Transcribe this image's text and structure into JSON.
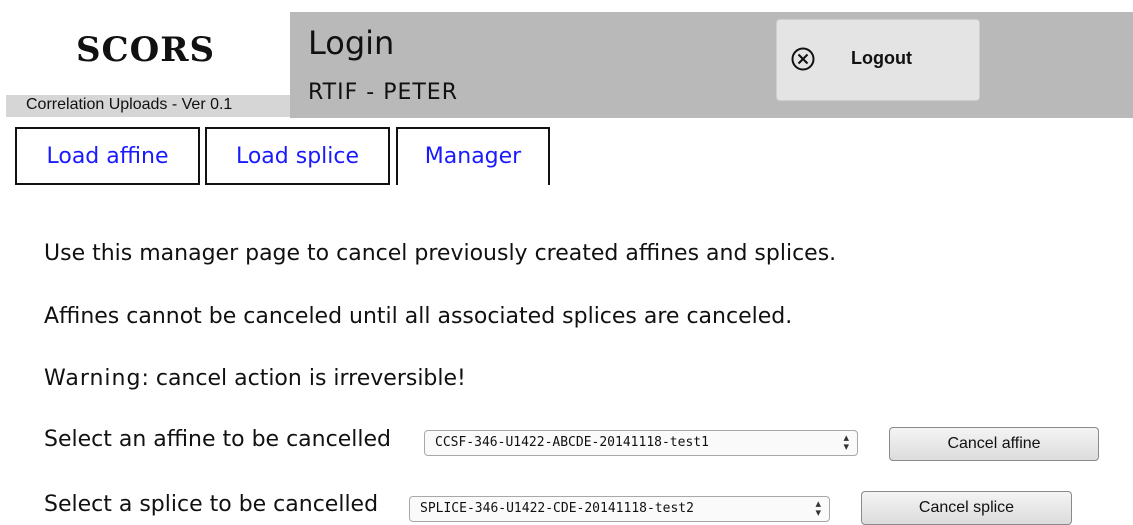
{
  "app": {
    "logo": "SCORS",
    "version": "Correlation Uploads -  Ver 0.1"
  },
  "header": {
    "title": "Login",
    "user": "RTIF - PETER",
    "logout_label": "Logout",
    "logout_icon": "close-circle-icon"
  },
  "tabs": [
    {
      "label": "Load affine",
      "active": false
    },
    {
      "label": "Load splice",
      "active": false
    },
    {
      "label": "Manager",
      "active": true
    }
  ],
  "content": {
    "intro": "Use this manager page to cancel previously created affines and splices.",
    "note": "Affines cannot be canceled until all associated splices are canceled.",
    "warning_label": "Warning",
    "warning_text": ": cancel action is irreversible!",
    "affine_prompt": "Select an affine to be cancelled",
    "affine_selected": "CCSF-346-U1422-ABCDE-20141118-test1",
    "affine_button": "Cancel affine",
    "splice_prompt": "Select a splice to be cancelled",
    "splice_selected": "SPLICE-346-U1422-CDE-20141118-test2",
    "splice_button": "Cancel splice"
  }
}
